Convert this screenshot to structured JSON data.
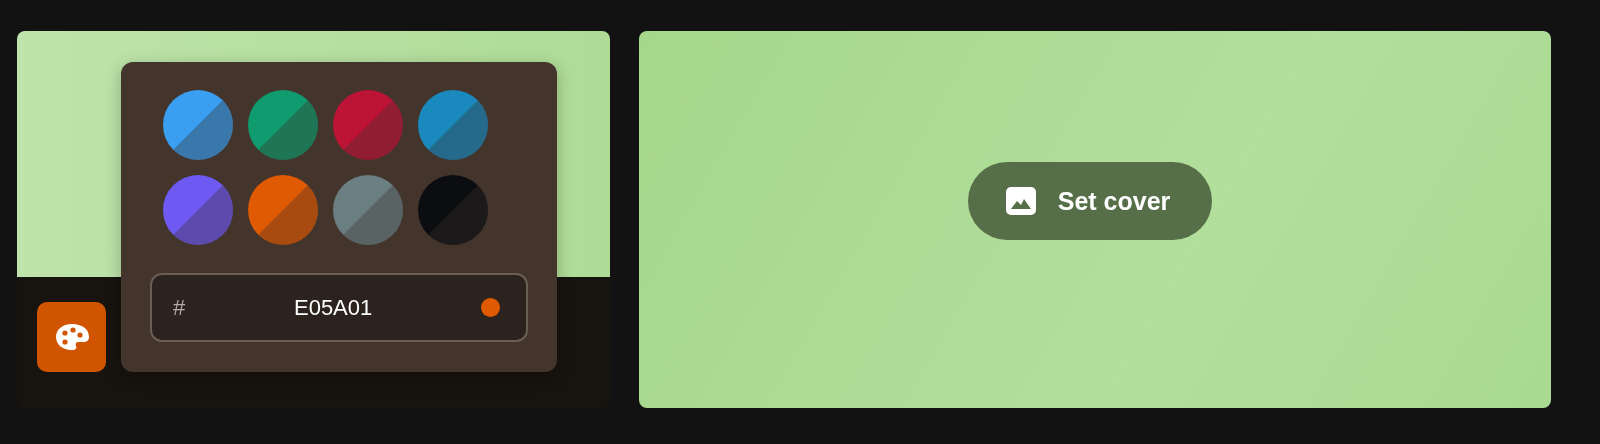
{
  "color_picker": {
    "swatches": [
      {
        "color": "#3a9ff0"
      },
      {
        "color": "#0f9b6e"
      },
      {
        "color": "#bd1335"
      },
      {
        "color": "#1a89bd"
      },
      {
        "color": "#6e5af2"
      },
      {
        "color": "#e05a01"
      },
      {
        "color": "#6b7f82"
      },
      {
        "color": "#0b0d10"
      }
    ],
    "hex_field": {
      "prefix": "#",
      "value": "E05A01",
      "color": "#e05a01"
    }
  },
  "cover": {
    "button": "Set cover"
  }
}
